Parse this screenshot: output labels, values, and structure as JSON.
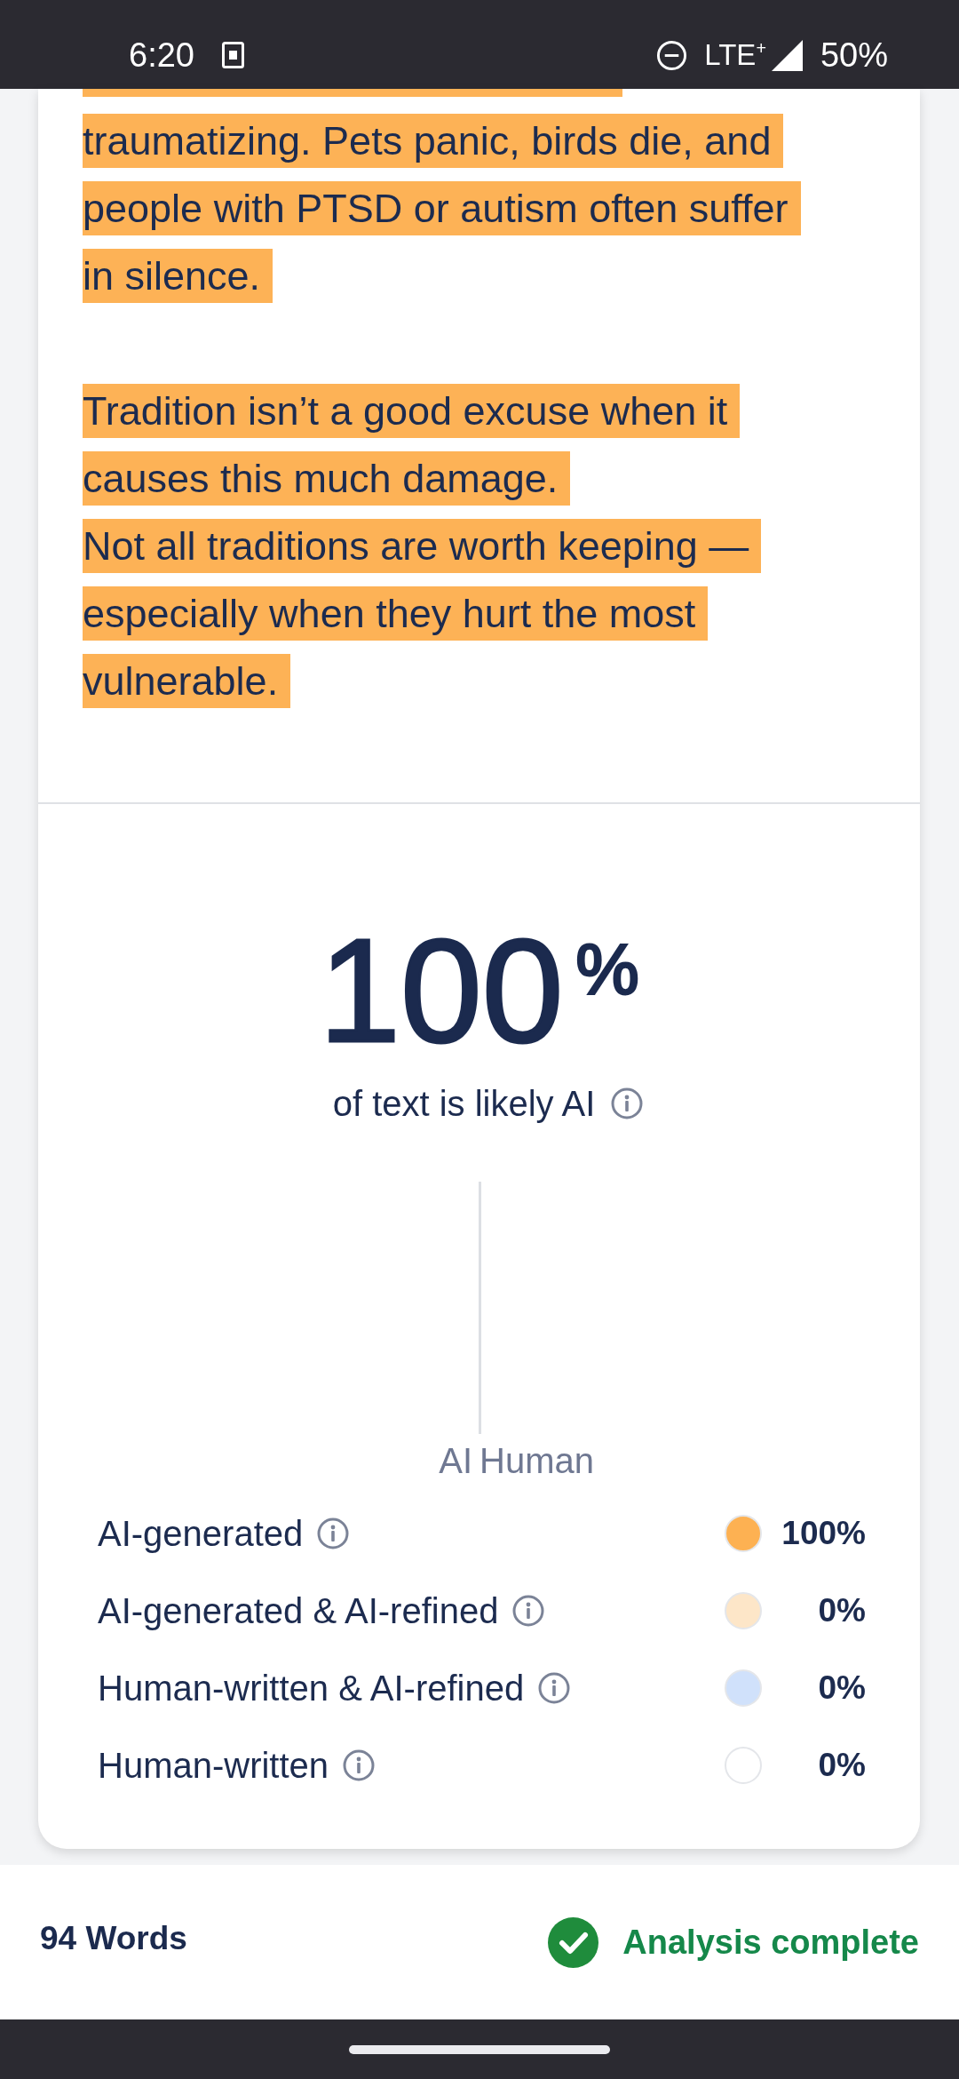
{
  "status_bar": {
    "time": "6:20",
    "network": "LTE$^{+}$",
    "battery": "50%"
  },
  "document": {
    "paragraphs": [
      {
        "highlighted": true,
        "lines": [
          "traumatizing. Pets panic, birds die, and",
          "people with PTSD or autism often suffer",
          "in silence."
        ]
      },
      {
        "highlighted": true,
        "lines": [
          "Tradition isn’t a good excuse when it",
          "causes this much damage.",
          "Not all traditions are worth keeping —",
          "especially when they hurt the most",
          "vulnerable."
        ]
      }
    ]
  },
  "score": {
    "percentage": "100$^{%}$",
    "caption": "of text is likely AI"
  },
  "chart": {
    "labels": [
      "AI",
      "Human"
    ]
  },
  "legend": [
    {
      "label": "AI-generated",
      "value": "100%",
      "color": "#fdb152"
    },
    {
      "label": "AI-generated & AI-refined",
      "value": "0%",
      "color": "#fde6c8"
    },
    {
      "label": "Human-written & AI-refined",
      "value": "0%",
      "color": "#d0e1fb"
    },
    {
      "label": "Human-written",
      "value": "0%",
      "color": "#ffffff"
    }
  ],
  "footer": {
    "word_count": "94 Words",
    "status": "Analysis complete"
  }
}
